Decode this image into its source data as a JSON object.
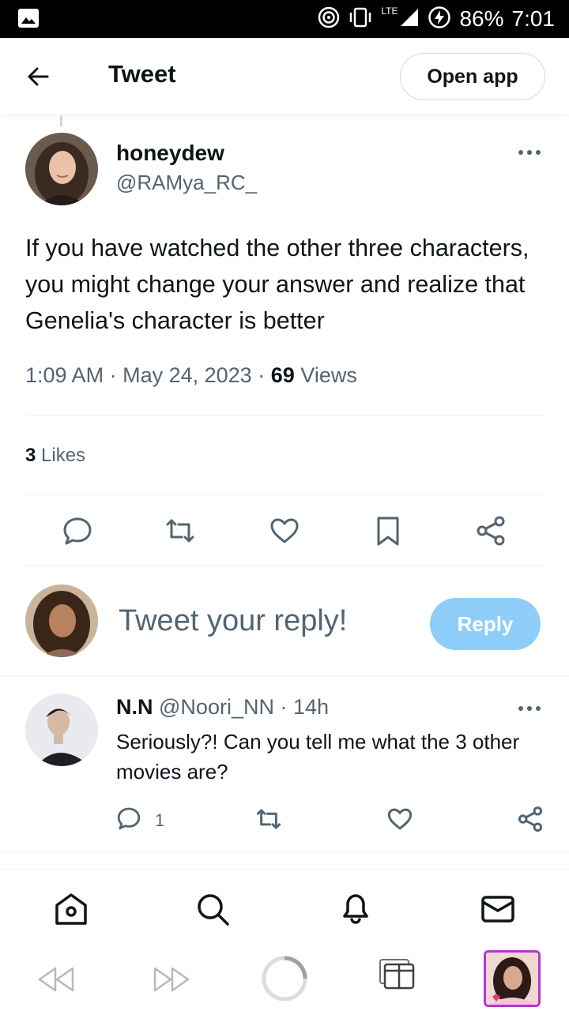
{
  "status_bar": {
    "network": "LTE",
    "battery": "86%",
    "time": "7:01"
  },
  "header": {
    "title": "Tweet",
    "open_app_label": "Open app"
  },
  "tweet": {
    "author_name": "honeydew",
    "author_handle": "@RAMya_RC_",
    "text": "If you have watched the other three characters, you might change your answer and realize that Genelia's character is better",
    "time": "1:09 AM",
    "date": "May 24, 2023",
    "views_count": "69",
    "views_label": "Views",
    "likes_count": "3",
    "likes_label": "Likes",
    "separator": "·"
  },
  "composer": {
    "placeholder": "Tweet your reply!",
    "reply_label": "Reply"
  },
  "reply": {
    "name": "N.N",
    "handle": "@Noori_NN",
    "time": "14h",
    "text": "Seriously?! Can you tell me what the 3 other movies are?",
    "reply_count": "1"
  },
  "colors": {
    "text": "#0f1419",
    "secondary": "#536471",
    "reply_button": "#8ecdf8",
    "divider": "#eff3f4"
  },
  "icons": {
    "back": "arrow-left-icon",
    "more": "more-horizontal-icon",
    "reply": "comment-icon",
    "retweet": "retweet-icon",
    "like": "heart-icon",
    "bookmark": "bookmark-icon",
    "share": "share-icon",
    "home": "home-icon",
    "search": "search-icon",
    "notifications": "bell-icon",
    "messages": "mail-icon"
  }
}
